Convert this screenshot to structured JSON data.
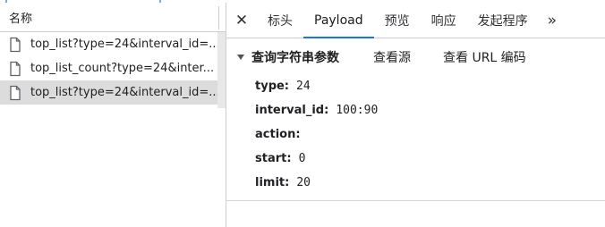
{
  "left_panel": {
    "header": "名称",
    "files": [
      {
        "name": "top_list?type=24&interval_id=...",
        "selected": false
      },
      {
        "name": "top_list_count?type=24&inter...",
        "selected": false
      },
      {
        "name": "top_list?type=24&interval_id=...",
        "selected": true
      }
    ]
  },
  "tabs": {
    "close": "✕",
    "items": [
      "标头",
      "Payload",
      "预览",
      "响应",
      "发起程序"
    ],
    "active": "Payload",
    "more": "»"
  },
  "payload": {
    "section_title": "查询字符串参数",
    "view_source": "查看源",
    "view_url_encoded": "查看 URL 编码",
    "params": [
      {
        "key": "type:",
        "value": "24"
      },
      {
        "key": "interval_id:",
        "value": "100:90"
      },
      {
        "key": "action:",
        "value": ""
      },
      {
        "key": "start:",
        "value": "0"
      },
      {
        "key": "limit:",
        "value": "20"
      }
    ]
  }
}
